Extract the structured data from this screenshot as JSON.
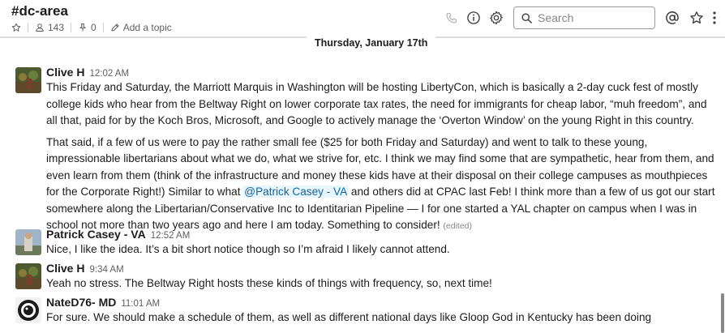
{
  "channel": {
    "name": "#dc-area",
    "member_count": "143",
    "pinned_count": "0",
    "add_topic_label": "Add a topic"
  },
  "header_icons": [
    "phone-icon",
    "info-icon",
    "gear-icon",
    "mention-icon",
    "star-icon"
  ],
  "search": {
    "placeholder": "Search"
  },
  "date_divider": "Thursday, January 17th",
  "messages": [
    {
      "author": "Clive H",
      "time": "12:02 AM",
      "p1": "This Friday and Saturday, the Marriott Marquis in Washington will be hosting LibertyCon, which is basically a 2-day cuck fest of mostly college kids who hear from the Beltway Right on lower corporate tax rates, the need for immigrants for cheap labor, “muh freedom”, and all that, paid for by the Koch Bros, Microsoft, and Google to actively manage the ‘Overton Window’ on the young Right in this country.",
      "p2_before": "That said, if a few of us were to pay the rather small fee ($25 for both Friday and Saturday) and went to talk to these young, impressionable libertarians about what we do, what we strive for, etc. I think we may find some that are sympathetic, hear from them, and even learn from them (think of the infrastructure and money these kids have at their disposal on their college campuses as mouthpieces for the Corporate Right!) Similar to what",
      "p2_mention": "@Patrick Casey - VA",
      "p2_after": "and others did at CPAC last Feb! I think more than a few of us got our start somewhere along the Libertarian/Conservative Inc to Identitarian Pipeline — I for one started a YAL chapter on campus when I was in school not more than two years ago and here I am today. Something to consider!",
      "edited": "(edited)"
    },
    {
      "author": "Patrick Casey - VA",
      "time": "12:52 AM",
      "text": "Nice, I like the idea. It’s a bit short notice though so I’m afraid I likely cannot attend."
    },
    {
      "author": "Clive H",
      "time": "9:34 AM",
      "text": "Yeah no stress. The Beltway Right hosts these kinds of things with frequency, so, next time!"
    },
    {
      "author": "NateD76- MD",
      "time": "11:01 AM",
      "text": "For sure. We should make a schedule of them, as well as different national days like Gloop God in Kentucky has been doing"
    }
  ],
  "colors": {
    "mention_text": "#1264a3",
    "mention_bg": "#e8f5fa",
    "muted": "#616061",
    "divider": "#dddddd"
  }
}
